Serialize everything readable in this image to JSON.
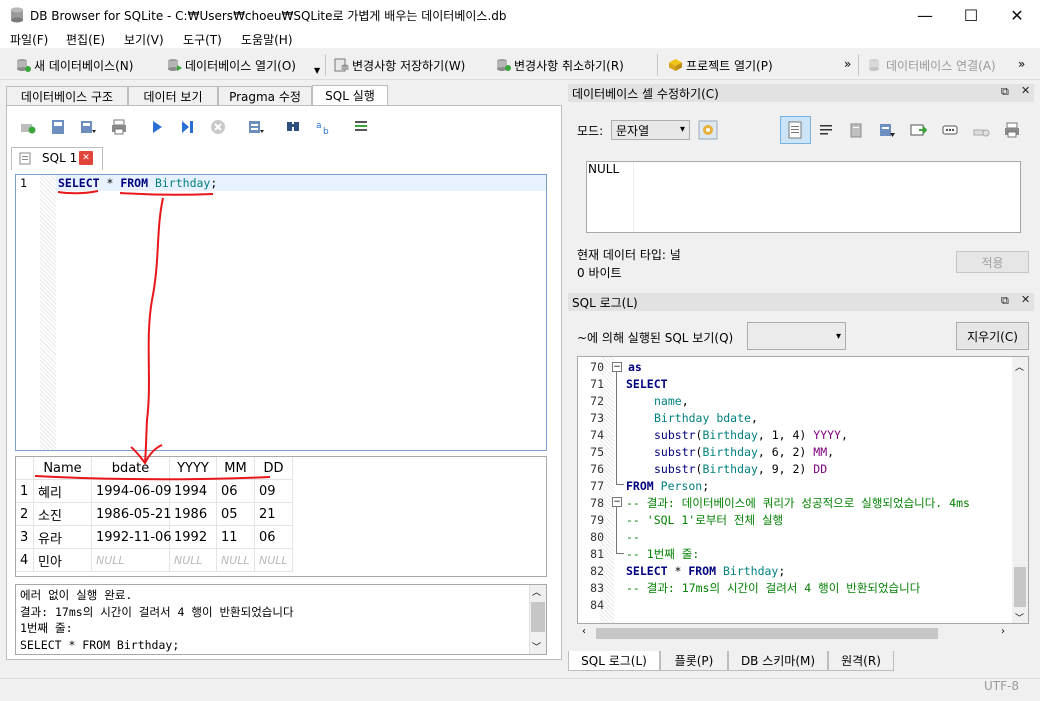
{
  "window": {
    "title": "DB Browser for SQLite - C:₩Users₩choeu₩SQLite로 가볍게 배우는 데이터베이스.db",
    "minimize": "—",
    "maximize": "☐",
    "close": "✕"
  },
  "menu": [
    "파일(F)",
    "편집(E)",
    "보기(V)",
    "도구(T)",
    "도움말(H)"
  ],
  "toolbar": {
    "new_db": "새 데이터베이스(N)",
    "open_db": "데이터베이스 열기(O)",
    "write_changes": "변경사항 저장하기(W)",
    "revert_changes": "변경사항 취소하기(R)",
    "open_project": "프로젝트 열기(P)",
    "attach_db": "데이터베이스 연결(A)",
    "overflow": "»"
  },
  "main_tabs": [
    "데이터베이스 구조",
    "데이터 보기",
    "Pragma 수정",
    "SQL 실행"
  ],
  "sql_tab": {
    "label": "SQL 1",
    "close": "✕"
  },
  "editor": {
    "line_no": "1",
    "tokens": [
      "SELECT",
      " * ",
      "FROM",
      " Birthday",
      ";"
    ]
  },
  "grid": {
    "headers": [
      "Name",
      "bdate",
      "YYYY",
      "MM",
      "DD"
    ],
    "rows": [
      {
        "n": "1",
        "cells": [
          "혜리",
          "1994-06-09",
          "1994",
          "06",
          "09"
        ]
      },
      {
        "n": "2",
        "cells": [
          "소진",
          "1986-05-21",
          "1986",
          "05",
          "21"
        ]
      },
      {
        "n": "3",
        "cells": [
          "유라",
          "1992-11-06",
          "1992",
          "11",
          "06"
        ]
      },
      {
        "n": "4",
        "cells": [
          "민아",
          "NULL",
          "NULL",
          "NULL",
          "NULL"
        ]
      }
    ]
  },
  "messages": [
    "에러 없이 실행 완료.",
    "결과: 17ms의 시간이 걸려서 4 행이 반환되었습니다",
    "1번째 줄:",
    "SELECT * FROM Birthday;"
  ],
  "cell_editor": {
    "title": "데이터베이스 셀 수정하기(C)",
    "mode_label": "모드:",
    "mode_value": "문자열",
    "cell_value": "NULL",
    "type_label": "현재 데이터 타입: 널",
    "size_label": "0 바이트",
    "apply": "적용"
  },
  "sql_log": {
    "title": "SQL 로그(L)",
    "submitted_by_label": "~에 의해 실행된 SQL 보기(Q)",
    "clear": "지우기(C)",
    "lines": [
      {
        "n": "70",
        "t": "as"
      },
      {
        "n": "71",
        "t": "SELECT"
      },
      {
        "n": "72",
        "t": "name,"
      },
      {
        "n": "73",
        "t": "Birthday bdate,"
      },
      {
        "n": "74",
        "t": "substr(Birthday, 1, 4) YYYY,"
      },
      {
        "n": "75",
        "t": "substr(Birthday, 6, 2) MM,"
      },
      {
        "n": "76",
        "t": "substr(Birthday, 9, 2) DD"
      },
      {
        "n": "77",
        "t": "FROM Person;"
      },
      {
        "n": "78",
        "t": "-- 결과:  데이터베이스에 쿼리가 성공적으로 실행되었습니다. 4ms"
      },
      {
        "n": "79",
        "t": "-- 'SQL 1'로부터 전체 실행"
      },
      {
        "n": "80",
        "t": "--"
      },
      {
        "n": "81",
        "t": "-- 1번째 줄:"
      },
      {
        "n": "82",
        "t": "SELECT * FROM Birthday;"
      },
      {
        "n": "83",
        "t": "-- 결과: 17ms의 시간이 걸려서 4 행이 반환되었습니다"
      },
      {
        "n": "84",
        "t": ""
      }
    ]
  },
  "bottom_tabs": [
    "SQL 로그(L)",
    "플롯(P)",
    "DB 스키마(M)",
    "원격(R)"
  ],
  "status": {
    "encoding": "UTF-8"
  },
  "colors": {
    "annotation": "#e8161a",
    "keyword": "#00007f",
    "comment": "#007f00",
    "string": "#7f007f",
    "table": "#007f7f"
  }
}
